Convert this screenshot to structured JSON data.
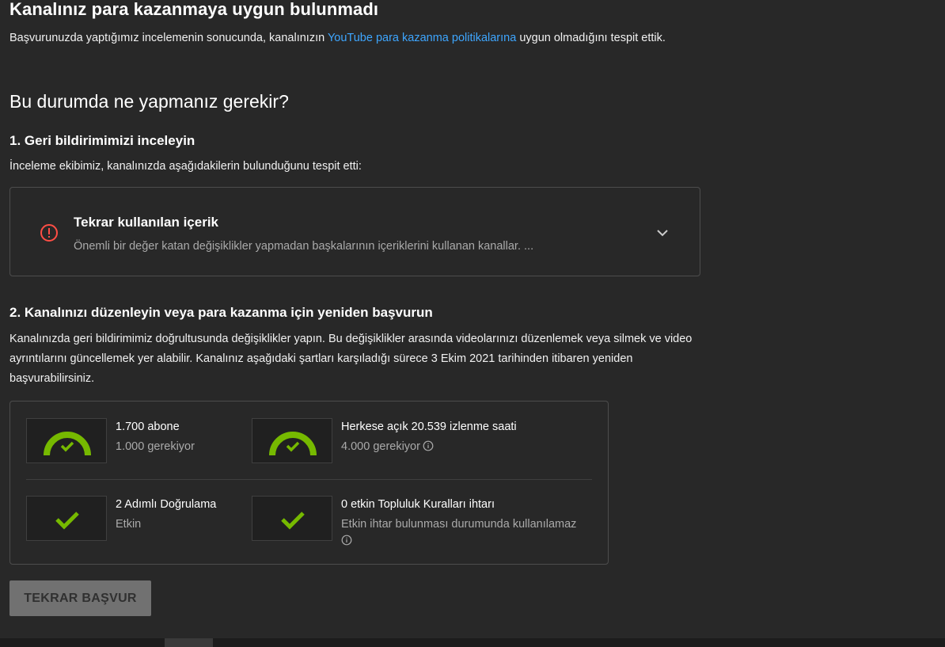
{
  "header": {
    "title": "Kanalınız para kazanmaya uygun bulunmadı",
    "intro_before": "Başvurunuzda yaptığımız incelemenin sonucunda, kanalınızın ",
    "intro_link": "YouTube para kazanma politikalarına",
    "intro_after": " uygun olmadığını tespit ettik."
  },
  "section_title": "Bu durumda ne yapmanız gerekir?",
  "step1": {
    "title": "1. Geri bildirimimizi inceleyin",
    "description": "İnceleme ekibimiz, kanalınızda aşağıdakilerin bulunduğunu tespit etti:",
    "issue": {
      "icon": "error-icon",
      "title": "Tekrar kullanılan içerik",
      "summary": "Önemli bir değer katan değişiklikler yapmadan başkalarının içeriklerini kullanan kanallar. ..."
    }
  },
  "step2": {
    "title": "2. Kanalınızı düzenleyin veya para kazanma için yeniden başvurun",
    "description": "Kanalınızda geri bildirimimiz doğrultusunda değişiklikler yapın. Bu değişiklikler arasında videolarınızı düzenlemek veya silmek ve video ayrıntılarını güncellemek yer alabilir. Kanalınız aşağıdaki şartları karşıladığı sürece 3 Ekim 2021 tarihinden itibaren yeniden başvurabilirsiniz."
  },
  "requirements": [
    {
      "icon": "gauge-check-icon",
      "title": "1.700 abone",
      "subtitle": "1.000 gerekiyor",
      "has_info": false
    },
    {
      "icon": "gauge-check-icon",
      "title": "Herkese açık 20.539 izlenme saati",
      "subtitle": "4.000 gerekiyor",
      "has_info": true
    },
    {
      "icon": "check-icon",
      "title": "2 Adımlı Doğrulama",
      "subtitle": "Etkin",
      "has_info": false
    },
    {
      "icon": "check-icon",
      "title": "0 etkin Topluluk Kuralları ihtarı",
      "subtitle": "Etkin ihtar bulunması durumunda kullanılamaz",
      "has_info": true
    }
  ],
  "actions": {
    "reapply_label": "TEKRAR BAŞVUR"
  },
  "colors": {
    "background": "#282828",
    "link": "#3ea6ff",
    "success": "#2ba640",
    "gauge": "#76b900",
    "error": "#ff4e45"
  }
}
